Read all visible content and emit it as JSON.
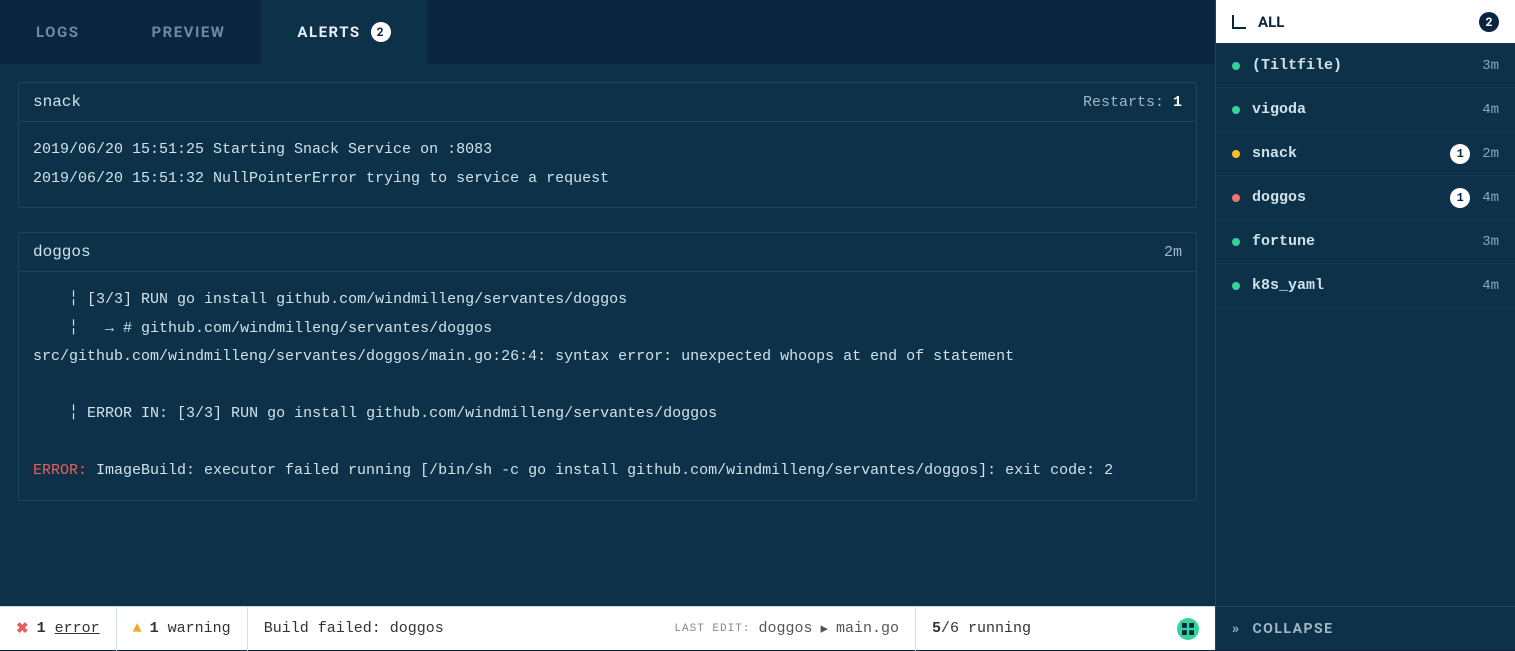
{
  "tabs": {
    "logs": "LOGS",
    "preview": "PREVIEW",
    "alerts": "ALERTS",
    "alerts_count": "2"
  },
  "panels": {
    "snack": {
      "title": "snack",
      "meta_label": "Restarts: ",
      "meta_value": "1",
      "line1": "2019/06/20 15:51:25 Starting Snack Service on :8083",
      "line2": "2019/06/20 15:51:32 NullPointerError trying to service a request"
    },
    "doggos": {
      "title": "doggos",
      "meta_value": "2m",
      "line1": "    ╎ [3/3] RUN go install github.com/windmilleng/servantes/doggos",
      "line2": "    ╎   → # github.com/windmilleng/servantes/doggos",
      "line3": "src/github.com/windmilleng/servantes/doggos/main.go:26:4: syntax error: unexpected whoops at end of statement",
      "line4": "    ╎ ERROR IN: [3/3] RUN go install github.com/windmilleng/servantes/doggos",
      "line5_pre": "ERROR:",
      "line5_post": " ImageBuild: executor failed running [/bin/sh -c go install github.com/windmilleng/servantes/doggos]: exit code: 2"
    }
  },
  "sidebar": {
    "all_label": "ALL",
    "all_count": "2",
    "items": [
      {
        "name": "(Tiltfile)",
        "age": "3m",
        "color": "green",
        "badge": null
      },
      {
        "name": "vigoda",
        "age": "4m",
        "color": "green",
        "badge": null
      },
      {
        "name": "snack",
        "age": "2m",
        "color": "yellow",
        "badge": "1"
      },
      {
        "name": "doggos",
        "age": "4m",
        "color": "red",
        "badge": "1"
      },
      {
        "name": "fortune",
        "age": "3m",
        "color": "green",
        "badge": null
      },
      {
        "name": "k8s_yaml",
        "age": "4m",
        "color": "green",
        "badge": null
      }
    ],
    "collapse": "COLLAPSE"
  },
  "status": {
    "errors_count": "1",
    "errors_label": "error",
    "warnings_count": "1",
    "warnings_label": "warning",
    "build_msg": "Build failed: doggos",
    "last_edit_label": "LAST EDIT:",
    "last_edit_target": "doggos",
    "last_edit_file": "main.go",
    "running_num": "5",
    "running_den": "/6 running"
  }
}
